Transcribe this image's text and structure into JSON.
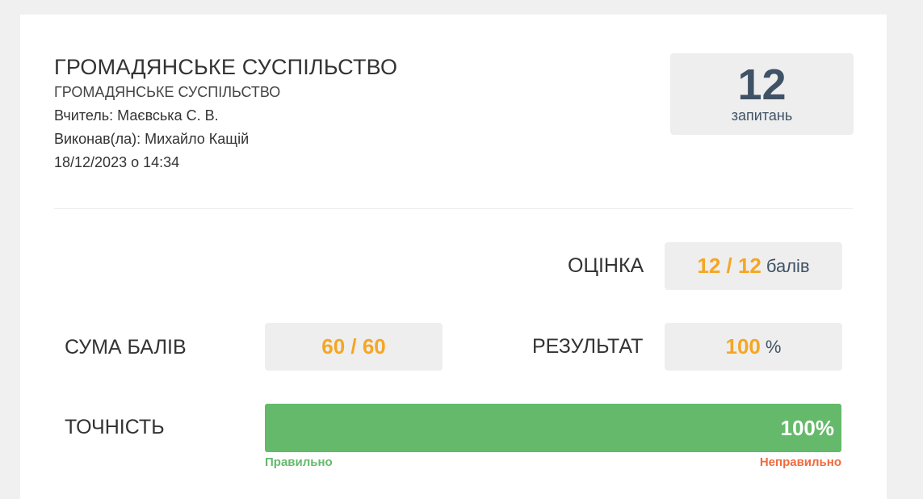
{
  "header": {
    "title": "ГРОМАДЯНСЬКЕ СУСПІЛЬСТВО",
    "subtitle": "ГРОМАДЯНСЬКЕ СУСПІЛЬСТВО",
    "teacher": "Вчитель: Маєвська С. В.",
    "performer": "Виконав(ла): Михайло Кащій",
    "datetime": "18/12/2023 о 14:34"
  },
  "questions": {
    "count": "12",
    "label": "запитань"
  },
  "grade": {
    "label": "ОЦІНКА",
    "value": "12 / 12",
    "unit": "балів"
  },
  "sum": {
    "label": "СУМА БАЛІВ",
    "value": "60 / 60"
  },
  "result": {
    "label": "РЕЗУЛЬТАТ",
    "value": "100",
    "unit": "%"
  },
  "accuracy": {
    "label": "ТОЧНІСТЬ",
    "percent_text": "100%",
    "fraction": 1.0,
    "correct_label": "Правильно",
    "incorrect_label": "Неправильно"
  },
  "colors": {
    "accent_value": "#f5a623",
    "progress_correct": "#65b96a",
    "incorrect": "#f06a3c",
    "slate": "#3f5266"
  }
}
